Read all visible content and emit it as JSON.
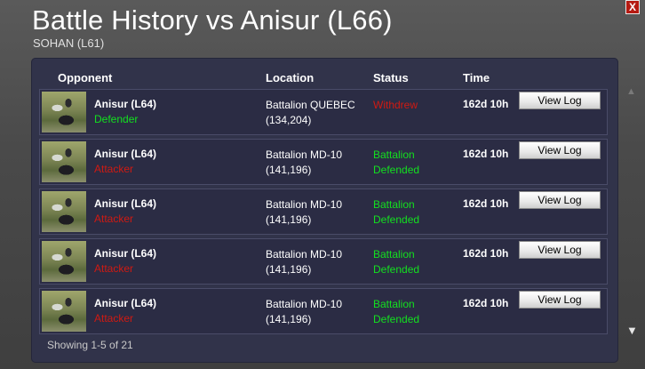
{
  "window": {
    "title": "Battle History vs Anisur (L66)",
    "subtitle": "SOHAN (L61)",
    "close_label": "X"
  },
  "table": {
    "headers": {
      "opponent": "Opponent",
      "location": "Location",
      "status": "Status",
      "time": "Time"
    },
    "rows": [
      {
        "name": "Anisur (L64)",
        "role": "Defender",
        "location_line1": "Battalion QUEBEC",
        "location_line2": "(134,204)",
        "status_line1": "Withdrew",
        "status_line2": "",
        "time": "162d 10h",
        "button": "View Log"
      },
      {
        "name": "Anisur (L64)",
        "role": "Attacker",
        "location_line1": "Battalion MD-10",
        "location_line2": "(141,196)",
        "status_line1": "Battalion",
        "status_line2": "Defended",
        "time": "162d 10h",
        "button": "View Log"
      },
      {
        "name": "Anisur (L64)",
        "role": "Attacker",
        "location_line1": "Battalion MD-10",
        "location_line2": "(141,196)",
        "status_line1": "Battalion",
        "status_line2": "Defended",
        "time": "162d 10h",
        "button": "View Log"
      },
      {
        "name": "Anisur (L64)",
        "role": "Attacker",
        "location_line1": "Battalion MD-10",
        "location_line2": "(141,196)",
        "status_line1": "Battalion",
        "status_line2": "Defended",
        "time": "162d 10h",
        "button": "View Log"
      },
      {
        "name": "Anisur (L64)",
        "role": "Attacker",
        "location_line1": "Battalion MD-10",
        "location_line2": "(141,196)",
        "status_line1": "Battalion",
        "status_line2": "Defended",
        "time": "162d 10h",
        "button": "View Log"
      }
    ],
    "footer": "Showing 1-5 of 21"
  },
  "colors": {
    "defender": "#13e01f",
    "attacker": "#d01a12",
    "close_button": "#b51a12"
  }
}
